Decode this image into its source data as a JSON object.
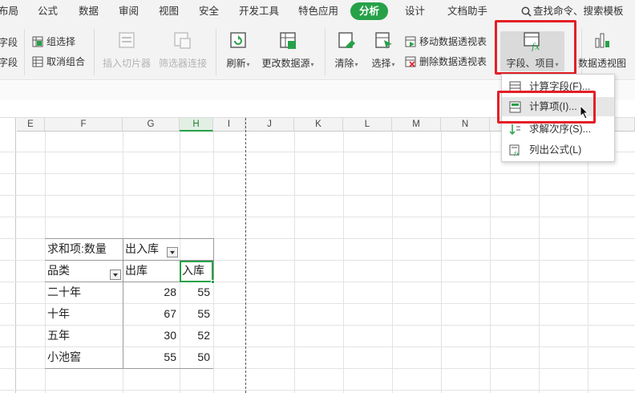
{
  "menubar": {
    "items": [
      "布局",
      "公式",
      "数据",
      "审阅",
      "视图",
      "安全",
      "开发工具",
      "特色应用",
      "分析",
      "设计",
      "文档助手"
    ],
    "active": "分析",
    "search_label": "查找命令、搜索模板"
  },
  "ribbon": {
    "field_top": "字段",
    "field_bottom": "字段",
    "group_select": "组选择",
    "ungroup": "取消组合",
    "insert_slicer": "插入切片器",
    "filter_connect": "筛选器连接",
    "refresh": "刷新",
    "change_source": "更改数据源",
    "clear": "清除",
    "select": "选择",
    "move_pivot": "移动数据透视表",
    "delete_pivot": "删除数据透视表",
    "fields_items": "字段、项目",
    "pivot_chart": "数据透视图"
  },
  "columns": [
    "E",
    "F",
    "G",
    "H",
    "I",
    "J",
    "K",
    "L",
    "M",
    "N"
  ],
  "selected_column": "H",
  "pivot": {
    "value_header": "求和项:数量",
    "col_field": "出入库",
    "row_field": "品类",
    "col_out": "出库",
    "col_in": "入库",
    "rows": [
      {
        "name": "二十年",
        "out": "28",
        "in": "55"
      },
      {
        "name": "十年",
        "out": "67",
        "in": "55"
      },
      {
        "name": "五年",
        "out": "30",
        "in": "52"
      },
      {
        "name": "小池窖",
        "out": "55",
        "in": "50"
      }
    ]
  },
  "dropdown": {
    "calc_field": "计算字段(F)...",
    "calc_item": "计算项(I)...",
    "solve_order": "求解次序(S)...",
    "list_formulas": "列出公式(L)"
  },
  "colors": {
    "accent": "#26a148",
    "highlight_box": "#e31f26"
  }
}
